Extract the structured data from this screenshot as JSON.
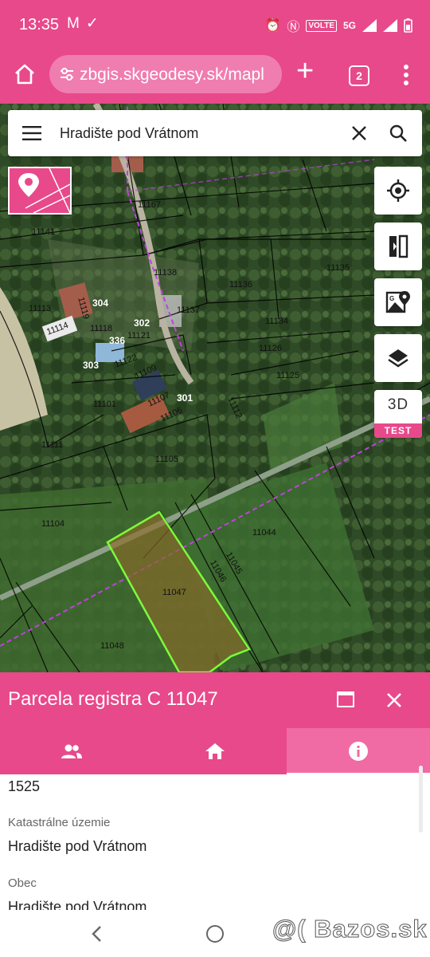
{
  "status_bar": {
    "time": "13:35",
    "network": "5G",
    "volte": "VOLTE"
  },
  "browser": {
    "url": "zbgis.skgeodesy.sk/mapl",
    "tab_count": "2"
  },
  "search": {
    "query": "Hradište pod Vrátnom"
  },
  "map": {
    "button_3d": "3D",
    "button_3d_badge": "TEST",
    "parcel_labels": [
      "11167",
      "11141",
      "11138",
      "11136",
      "11135",
      "11113",
      "11119",
      "304",
      "11114",
      "11118",
      "302",
      "11121",
      "336",
      "11137",
      "11134",
      "11126",
      "11125",
      "303",
      "11122",
      "11109",
      "11101",
      "11107",
      "301",
      "11106",
      "11112",
      "11111",
      "11105",
      "11104",
      "11044",
      "11045",
      "11046",
      "11047",
      "11048"
    ]
  },
  "panel": {
    "title": "Parcela registra C 11047",
    "fields": [
      {
        "key": "",
        "value": "1525"
      },
      {
        "key": "Katastrálne územie",
        "value": "Hradište pod Vrátnom"
      },
      {
        "key": "Obec",
        "value": "Hradište pod Vrátnom"
      }
    ]
  },
  "watermark": "@( Bazos.sk",
  "colors": {
    "accent": "#e8498a",
    "selected_parcel": "#7cfc3a"
  }
}
